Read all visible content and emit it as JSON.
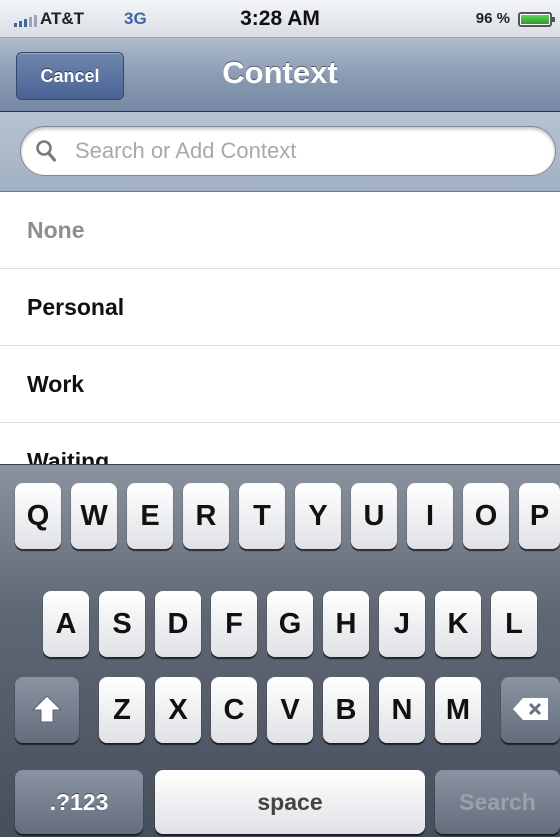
{
  "status_bar": {
    "carrier": "AT&T",
    "network": "3G",
    "time": "3:28 AM",
    "battery_percent": "96 %"
  },
  "nav_bar": {
    "cancel_label": "Cancel",
    "title": "Context"
  },
  "search": {
    "placeholder": "Search or Add Context",
    "value": ""
  },
  "contexts": [
    {
      "label": "None"
    },
    {
      "label": "Personal"
    },
    {
      "label": "Work"
    },
    {
      "label": "Waiting"
    }
  ],
  "keyboard": {
    "row1": [
      "Q",
      "W",
      "E",
      "R",
      "T",
      "Y",
      "U",
      "I",
      "O",
      "P"
    ],
    "row2": [
      "A",
      "S",
      "D",
      "F",
      "G",
      "H",
      "J",
      "K",
      "L"
    ],
    "row3": [
      "Z",
      "X",
      "C",
      "V",
      "B",
      "N",
      "M"
    ],
    "numbers_label": ".?123",
    "space_label": "space",
    "search_label": "Search",
    "shift_icon": "shift-arrow-icon",
    "backspace_icon": "backspace-icon"
  },
  "colors": {
    "nav_tint": "#8b9cb4",
    "network_blue": "#3d66a8",
    "battery_green": "#4cc24a"
  }
}
